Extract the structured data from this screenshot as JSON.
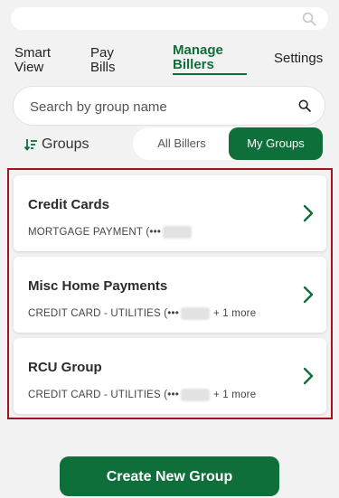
{
  "header": {
    "search_icon": "search-icon"
  },
  "tabs": [
    {
      "line1": "Smart",
      "line2": "View"
    },
    {
      "line1": "Pay",
      "line2": "Bills"
    },
    {
      "line1": "Manage",
      "line2": "Billers"
    },
    {
      "line1": "Settings",
      "line2": ""
    }
  ],
  "group_search": {
    "placeholder": "Search by group name",
    "value": ""
  },
  "sort": {
    "label": "Groups",
    "icon": "sort-icon"
  },
  "toggle": {
    "all": "All Billers",
    "mine": "My Groups",
    "selected": "My Groups"
  },
  "groups": [
    {
      "name": "Credit Cards",
      "prefix": "MORTGAGE PAYMENT (•••",
      "more": ""
    },
    {
      "name": "Misc Home Payments",
      "prefix": "CREDIT CARD - UTILITIES (•••",
      "more": "+ 1 more"
    },
    {
      "name": "RCU Group",
      "prefix": "CREDIT CARD - UTILITIES (•••",
      "more": "+ 1 more"
    }
  ],
  "actions": {
    "create_group": "Create New Group"
  },
  "colors": {
    "brand_green": "#0f6f3a",
    "highlight_red": "#a0151d",
    "background": "#f2f2f2"
  }
}
